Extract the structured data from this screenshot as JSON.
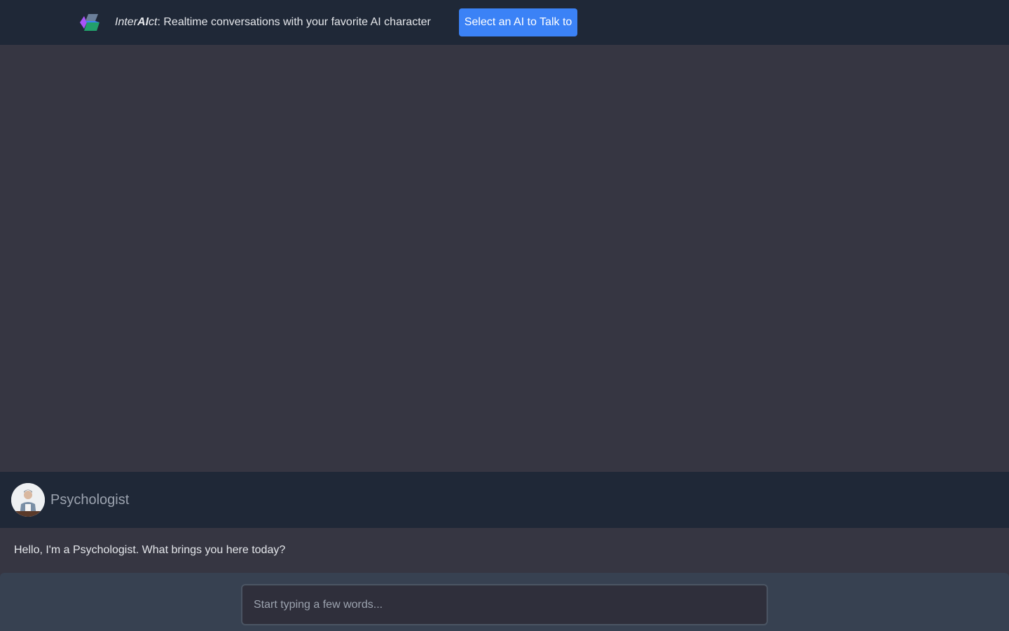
{
  "header": {
    "brand_pre": "Inter",
    "brand_bold": "AI",
    "brand_post": "ct",
    "tagline": ": Realtime conversations with your favorite AI character",
    "select_button_label": "Select an AI to Talk to"
  },
  "character": {
    "name": "Psychologist",
    "avatar_icon": "psychologist-avatar"
  },
  "conversation": {
    "greeting": "Hello, I'm a Psychologist. What brings you here today?"
  },
  "input": {
    "placeholder": "Start typing a few words...",
    "value": ""
  },
  "colors": {
    "header_bg": "#1f2837",
    "stage_bg": "#363642",
    "accent": "#3b82f6",
    "input_bar_bg": "#374151"
  }
}
